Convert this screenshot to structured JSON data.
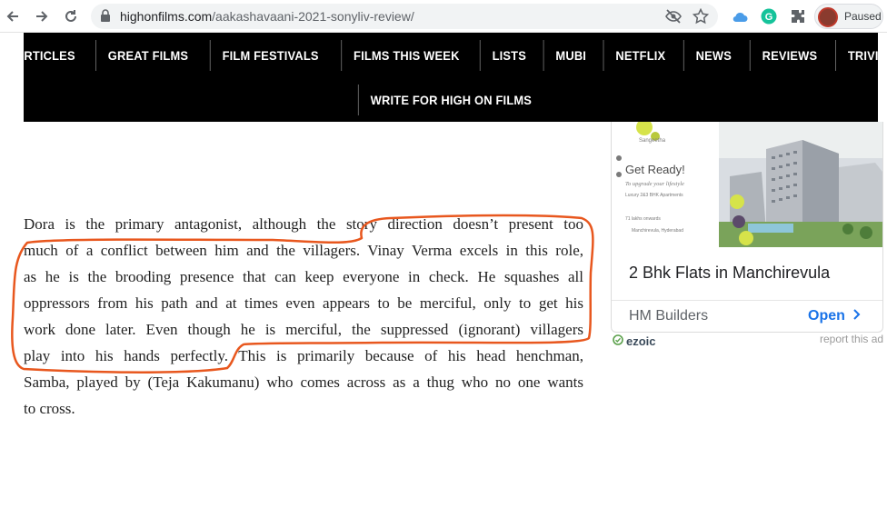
{
  "browser": {
    "url_domain": "highonfilms.com",
    "url_path": "/aakashavaani-2021-sonyliv-review/",
    "profile_status": "Paused",
    "icons": [
      "back-icon",
      "forward-icon",
      "reload-icon",
      "lock-icon",
      "eye-off-icon",
      "star-icon",
      "cloud-icon",
      "grammarly-icon",
      "extensions-icon"
    ]
  },
  "nav": {
    "row1": [
      "ARTICLES",
      "GREAT FILMS",
      "FILM FESTIVALS",
      "FILMS THIS WEEK",
      "LISTS",
      "MUBI",
      "NETFLIX",
      "NEWS",
      "REVIEWS",
      "TRIVIA"
    ],
    "row2": [
      "WRITE FOR HIGH ON FILMS"
    ]
  },
  "article": {
    "lines": [
      "Dora is the primary antagonist, although the story direction doesn’t present too",
      "much of a conflict between him and the villagers. Vinay Verma excels in this role,",
      "as he is the brooding presence that can keep everyone in check. He squashes all",
      "oppressors from his path and at times even appears to be merciful, only to get his",
      "work done later. Even though he is merciful, the suppressed (ignorant) villagers",
      "play into his hands perfectly. This is primarily because of his head henchman,",
      "Samba, played by (Teja Kakumanu) who comes across as a thug who no one wants",
      "to cross."
    ],
    "highlight_color": "#e8571e"
  },
  "ad": {
    "banner_headline": "Get Ready!",
    "banner_tagline": "To upgrade your lifestyle",
    "banner_sub": "Luxury 2&3 BHK Apartments",
    "banner_price": "71 lakhs onwards",
    "banner_location": "Manchirevula, Hyderabad",
    "title": "2 Bhk Flats in Manchirevula",
    "advertiser": "HM Builders",
    "cta": "Open",
    "ezoic_label": "ezoic",
    "report_label": "report this ad"
  },
  "colors": {
    "nav_bg": "#000000",
    "nav_text": "#ffffff",
    "link_blue": "#1a73e8",
    "highlight": "#e8571e"
  }
}
